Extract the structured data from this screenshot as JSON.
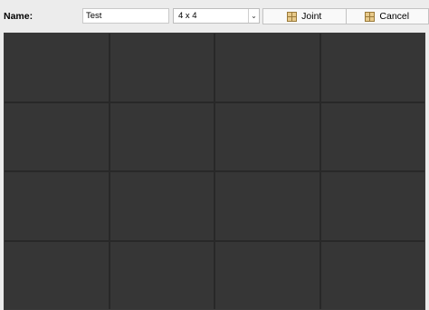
{
  "toolbar": {
    "name_label": "Name:",
    "name_value": "Test",
    "layout_select": {
      "value": "4 x 4",
      "arrow": "⌄"
    },
    "joint_label": "Joint",
    "cancel_label": "Cancel"
  },
  "grid": {
    "rows": 4,
    "cols": 4
  },
  "colors": {
    "toolbar_bg": "#ececec",
    "cell_bg": "#363636",
    "gap": "#282828"
  }
}
